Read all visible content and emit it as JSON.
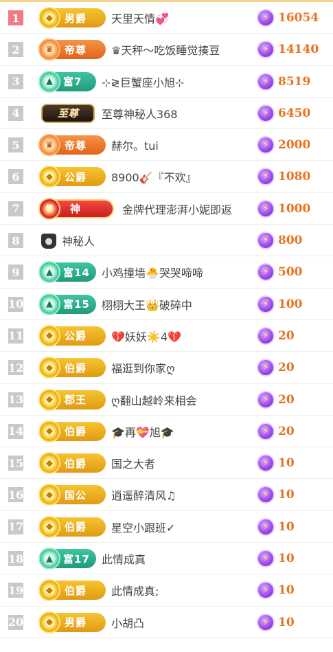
{
  "colors": {
    "amount": "#e8731f",
    "rank_default": "#c9c9c9",
    "rank_first": "#f07a85",
    "coin": "#a24cf0"
  },
  "rows": [
    {
      "rank": "1",
      "badge_type": "gold",
      "badge_label": "男爵",
      "name": "天里天情💞",
      "amount": "16054"
    },
    {
      "rank": "2",
      "badge_type": "orange",
      "badge_label": "帝尊",
      "name": "♛天秤〜吃饭睡觉揍豆",
      "amount": "14140"
    },
    {
      "rank": "3",
      "badge_type": "teal",
      "badge_label": "富7",
      "name": "⊹≷巨蟹座小旭⊹",
      "amount": "8519"
    },
    {
      "rank": "4",
      "badge_type": "zhizun",
      "badge_label": "至尊",
      "name": "至尊神秘人368",
      "amount": "6450"
    },
    {
      "rank": "5",
      "badge_type": "orange",
      "badge_label": "帝尊",
      "name": "赫尔。tui",
      "amount": "2000"
    },
    {
      "rank": "6",
      "badge_type": "gold",
      "badge_label": "公爵",
      "name": "8900🎸『不欢』",
      "amount": "1080"
    },
    {
      "rank": "7",
      "badge_type": "red",
      "badge_label": "神",
      "name": "金牌代理澎湃小妮即返",
      "amount": "1000"
    },
    {
      "rank": "8",
      "badge_type": "mystery",
      "badge_label": "",
      "name": "神秘人",
      "amount": "800"
    },
    {
      "rank": "9",
      "badge_type": "teal",
      "badge_label": "富14",
      "name": "小鸡撞墙🐣哭哭啼啼",
      "amount": "500"
    },
    {
      "rank": "10",
      "badge_type": "teal",
      "badge_label": "富15",
      "name": "栩栩大王👑破碎中",
      "amount": "100"
    },
    {
      "rank": "11",
      "badge_type": "gold",
      "badge_label": "公爵",
      "name": "💔妖妖☀️4💔",
      "amount": "20"
    },
    {
      "rank": "12",
      "badge_type": "gold",
      "badge_label": "伯爵",
      "name": "福逛到你家ღ",
      "amount": "20"
    },
    {
      "rank": "13",
      "badge_type": "gold",
      "badge_label": "郡王",
      "name": "ღ翻山越岭来相会",
      "amount": "20"
    },
    {
      "rank": "14",
      "badge_type": "gold",
      "badge_label": "伯爵",
      "name": "🎓再💝旭🎓",
      "amount": "20"
    },
    {
      "rank": "15",
      "badge_type": "gold",
      "badge_label": "伯爵",
      "name": "国之大者",
      "amount": "10"
    },
    {
      "rank": "16",
      "badge_type": "gold",
      "badge_label": "国公",
      "name": "逍遥醉清风♫",
      "amount": "10"
    },
    {
      "rank": "17",
      "badge_type": "gold",
      "badge_label": "伯爵",
      "name": "星空小跟班✓",
      "amount": "10"
    },
    {
      "rank": "18",
      "badge_type": "teal",
      "badge_label": "富17",
      "name": "此情成真",
      "amount": "10"
    },
    {
      "rank": "19",
      "badge_type": "gold",
      "badge_label": "伯爵",
      "name": "此情成真;",
      "amount": "10"
    },
    {
      "rank": "20",
      "badge_type": "gold",
      "badge_label": "男爵",
      "name": "小胡凸",
      "amount": "10"
    }
  ]
}
